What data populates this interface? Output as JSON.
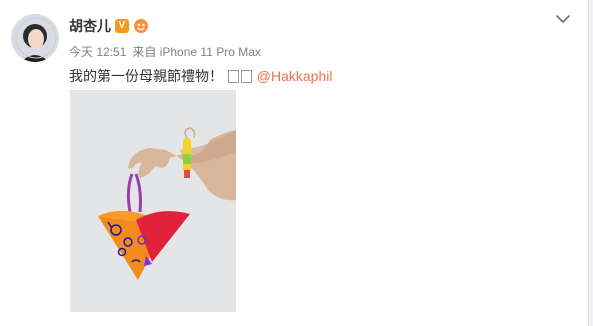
{
  "post": {
    "username": "胡杏儿",
    "vip_badge": "V",
    "timestamp": "今天 12:51",
    "source": "来自 iPhone 11 Pro Max",
    "text": "我的第一份母親節禮物！",
    "mention": "@Hakkaphil"
  },
  "icons": {
    "menu": "chevron-down-icon",
    "avatar": "profile-avatar",
    "member": "member-badge-icon"
  },
  "colors": {
    "mention": "#eb7350",
    "badge": "#f39b1c",
    "meta_text": "#808080",
    "photo_bg": "#e4e5e6"
  }
}
